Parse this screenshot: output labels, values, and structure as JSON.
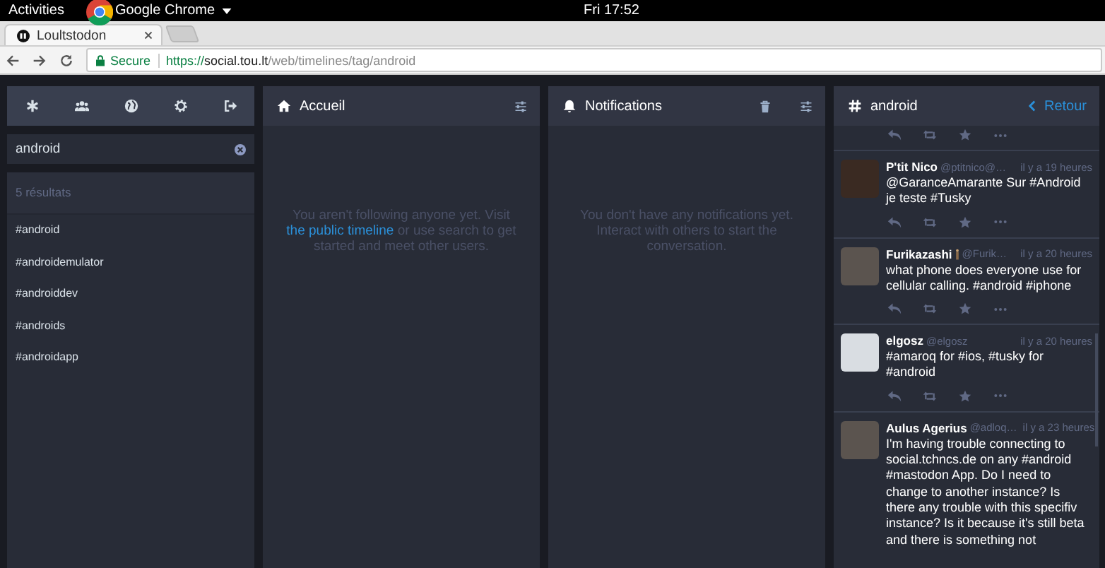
{
  "os_bar": {
    "activities": "Activities",
    "app_menu": "Google Chrome",
    "clock": "Fri 17:52"
  },
  "browser": {
    "tabs": [
      {
        "title": "Loultstodon",
        "selected": true
      }
    ],
    "url": {
      "secure_label": "Secure",
      "scheme": "https://",
      "host": "social.tou.lt",
      "path": "/web/timelines/tag/android"
    }
  },
  "drawer": {
    "search": {
      "value": "android"
    },
    "results_header": "5 résultats",
    "results": [
      "#android",
      "#androidemulator",
      "#androiddev",
      "#androids",
      "#androidapp"
    ]
  },
  "columns": [
    {
      "kind": "home",
      "title": "Accueil",
      "empty": {
        "before": "You aren't following anyone yet. Visit ",
        "link": "the public timeline",
        "after": " or use search to get started and meet other users."
      }
    },
    {
      "kind": "notifications",
      "title": "Notifications",
      "empty": {
        "before": "You don't have any notifications yet. Interact with others to start the conversation."
      }
    },
    {
      "kind": "hashtag",
      "title": "android",
      "back": "Retour",
      "statuses": [
        {
          "kind": "cut"
        },
        {
          "kind": "full",
          "name": "P'tit Nico",
          "handle": "@ptitnico@…",
          "time": "il y a 19 heures",
          "text": "@GaranceAmarante Sur #Android je teste #Tusky",
          "badge": false
        },
        {
          "kind": "full",
          "name": "Furikazashi",
          "handle": "@Furik…",
          "time": "il y a 20 heures",
          "text": "what phone does everyone use for cellular calling. #android #iphone",
          "badge": true
        },
        {
          "kind": "full",
          "name": "elgosz",
          "handle": "@elgosz",
          "time": "il y a 20 heures",
          "text": "#amaroq for #ios, #tusky for #android",
          "badge": false
        },
        {
          "kind": "last",
          "name": "Aulus Agerius",
          "handle": "@adloq…",
          "time": "il y a 23 heures",
          "text": "I'm having trouble connecting to social.tchncs.de on any #android #mastodon App. Do I need to change to another instance? Is there any trouble with this specifiv instance? Is it because it's still beta and there is something not",
          "badge": false
        }
      ]
    }
  ]
}
